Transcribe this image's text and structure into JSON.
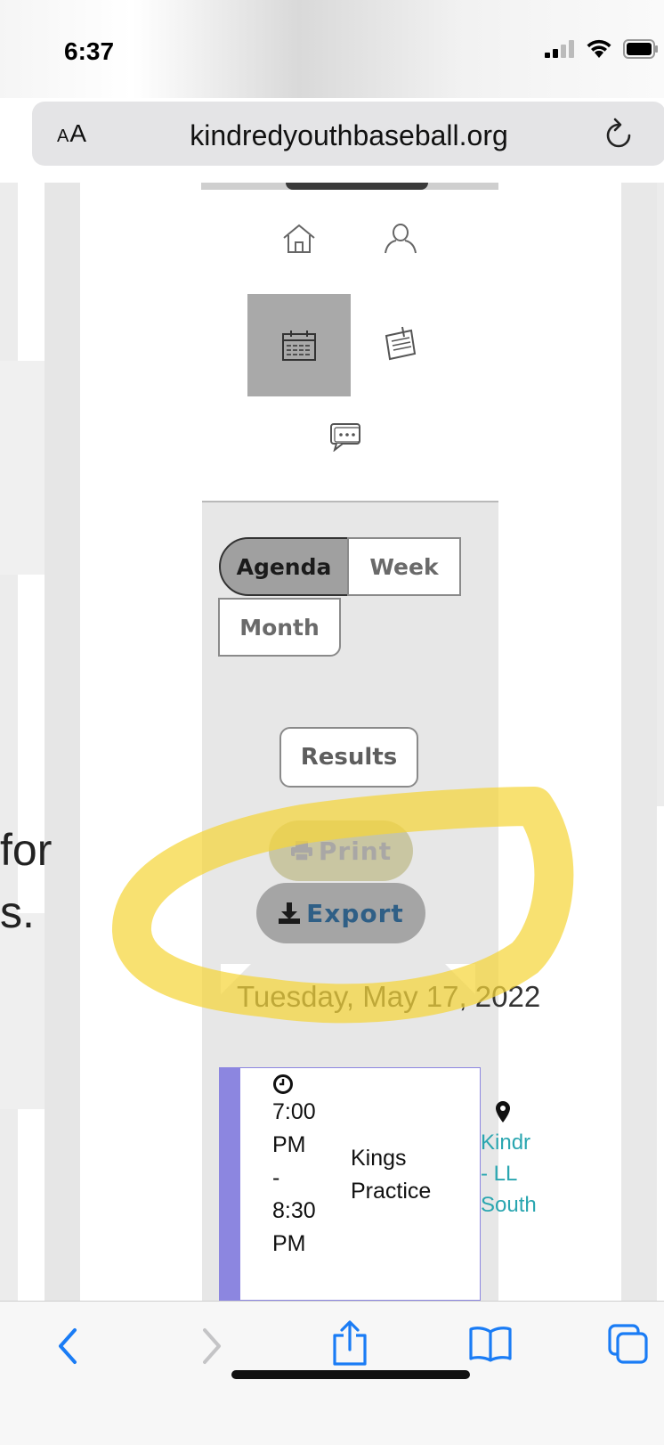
{
  "status_bar": {
    "time": "6:37",
    "icons": [
      "signal-icon",
      "wifi-icon",
      "battery-icon"
    ]
  },
  "address_bar": {
    "text_size_label_small": "A",
    "text_size_label_large": "A",
    "url": "kindredyouthbaseball.org",
    "reload_icon": "reload-icon"
  },
  "behind_text": {
    "line1": "for",
    "line2": "s."
  },
  "nav": {
    "icons": [
      "home-icon",
      "user-icon",
      "calendar-icon",
      "notepad-icon",
      "chat-icon"
    ],
    "selected": "calendar-icon"
  },
  "view_buttons": {
    "agenda": "Agenda",
    "week": "Week",
    "month": "Month",
    "selected": "Agenda"
  },
  "actions": {
    "results": "Results",
    "print": "Print",
    "export": "Export"
  },
  "date_heading": "Tuesday, May 17, 2022",
  "event": {
    "time_lines": [
      "7:00",
      "PM",
      "-",
      "8:30",
      "PM"
    ],
    "title_lines": [
      "Kings",
      "Practice"
    ],
    "location_lines": [
      "Kindr",
      "- LL",
      "South"
    ]
  },
  "colors": {
    "event_accent": "#8c86e0",
    "location_link": "#2aa6b0",
    "export_text": "#2f5f86",
    "highlight": "#f5d63a",
    "safari_blue": "#1a7cf5"
  },
  "toolbar": {
    "icons": [
      "back-icon",
      "forward-icon",
      "share-icon",
      "bookmarks-icon",
      "tabs-icon"
    ]
  }
}
